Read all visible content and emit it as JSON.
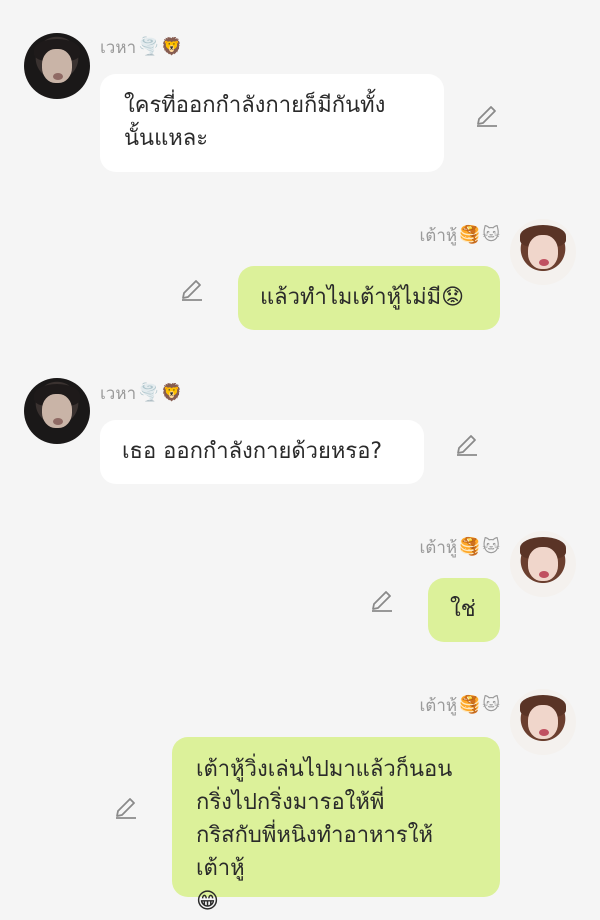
{
  "messages": [
    {
      "side": "left",
      "sender": "เวหา",
      "sender_emojis": [
        "🌪️",
        "🦁"
      ],
      "lines": [
        "ใครที่ออกกำลังกายก็มีกันทั้ง",
        "นั้นแหละ"
      ]
    },
    {
      "side": "right",
      "sender": "เต้าหู้",
      "sender_emojis": [
        "🥞",
        "🐱"
      ],
      "lines": [
        "แล้วทำไมเต้าหู้ไม่มี😟"
      ]
    },
    {
      "side": "left",
      "sender": "เวหา",
      "sender_emojis": [
        "🌪️",
        "🦁"
      ],
      "lines": [
        "เธอ ออกกำลังกายด้วยหรอ?"
      ]
    },
    {
      "side": "right",
      "sender": "เต้าหู้",
      "sender_emojis": [
        "🥞",
        "🐱"
      ],
      "lines": [
        "ใช่"
      ]
    },
    {
      "side": "right",
      "sender": "เต้าหู้",
      "sender_emojis": [
        "🥞",
        "🐱"
      ],
      "lines": [
        "เต้าหู้วิ่งเล่นไปมาแล้วก็นอน",
        "กริ่งไปกริ่งมารอให้พี่",
        "กริสกับพี่หนิงทำอาหารให้เต้าหู้",
        "😁"
      ]
    }
  ],
  "icons": {
    "edit": "pencil-icon",
    "avatar_left": "avatar-veha",
    "avatar_right": "avatar-taohu"
  },
  "colors": {
    "background": "#f5f5f5",
    "left_bubble": "#ffffff",
    "right_bubble": "#dcf19a",
    "name_text": "#9a9a9a",
    "message_text": "#2a2a2a"
  }
}
